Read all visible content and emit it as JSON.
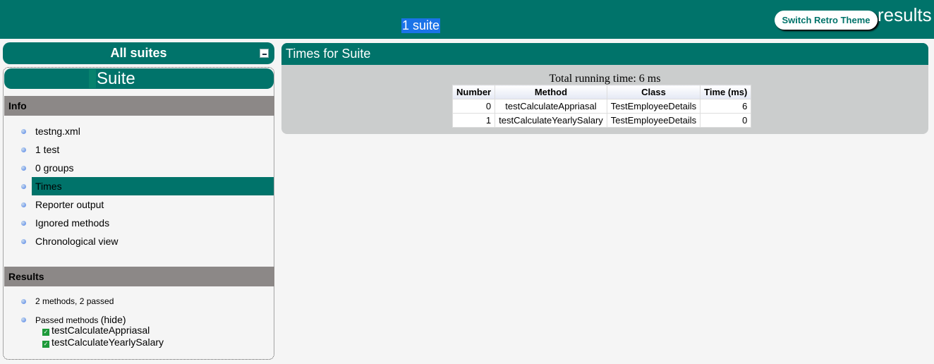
{
  "header": {
    "suite_count": "1 suite",
    "retro_button": "Switch Retro Theme",
    "title": "results"
  },
  "sidebar": {
    "all_suites": "All suites",
    "suite_name": "Suite",
    "info_title": "Info",
    "info_items": [
      "testng.xml",
      "1 test",
      "0 groups",
      "Times",
      "Reporter output",
      "Ignored methods",
      "Chronological view"
    ],
    "selected_item": "Times",
    "results_title": "Results",
    "summary": "2 methods, 2 passed",
    "passed_label": "Passed methods",
    "hide_link": "(hide)",
    "passed_methods": [
      "testCalculateAppriasal",
      "testCalculateYearlySalary"
    ]
  },
  "main": {
    "title": "Times for Suite",
    "total": "Total running time: 6 ms",
    "columns": [
      "Number",
      "Method",
      "Class",
      "Time (ms)"
    ],
    "rows": [
      [
        "0",
        "testCalculateAppriasal",
        "TestEmployeeDetails",
        "6"
      ],
      [
        "1",
        "testCalculateYearlySalary",
        "TestEmployeeDetails",
        "0"
      ]
    ]
  },
  "colors": {
    "brand": "#00736a",
    "section": "#8c8887"
  }
}
